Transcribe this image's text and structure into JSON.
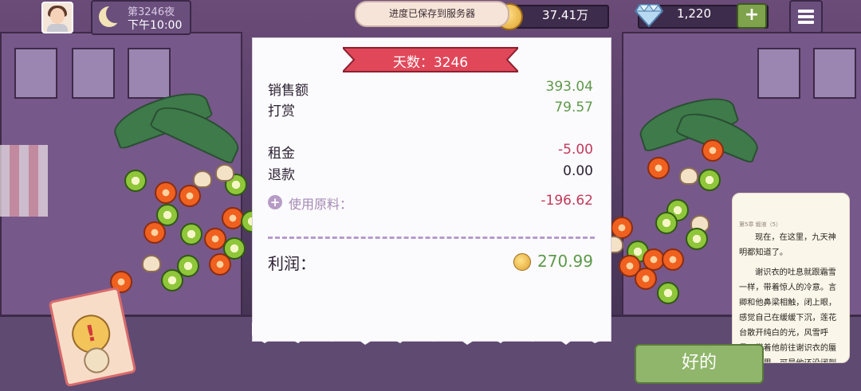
{
  "hud": {
    "night_label": "第3246夜",
    "time": "下午10:00",
    "coins": "37.41万",
    "gems": "1,220",
    "plus_label": "+",
    "save_toast": "进度已保存到服务器"
  },
  "receipt": {
    "day_title": "天数：3246",
    "rows": [
      {
        "label": "销售额",
        "value": "393.04"
      },
      {
        "label": "打赏",
        "value": "79.57"
      },
      {
        "label": "租金",
        "value": "-5.00"
      },
      {
        "label": "退款",
        "value": "0.00"
      }
    ],
    "ingredients_label": "使用原料：",
    "ingredients_value": "-196.62",
    "profit_label": "利润：",
    "profit_value": "270.99"
  },
  "book": {
    "top_line": "第5章  煅液（5）",
    "paragraph1": "现在，在这里，九天神明都知道了。",
    "paragraph2": "谢识衣的吐息就跟霜雪一样，带着惊人的冷意。言卿和他鼻梁相触，闭上眼，感觉自己在缓缓下沉，莲花台散开纯白的光，风雪呼号，带着他前往谢识衣的蜃楼幻境里。可是他还没闭到底，突然，发脚到"
  },
  "ok_label": "好的",
  "colors": {
    "accent_green": "#5e9a4a",
    "accent_red": "#c23a5a",
    "ribbon": "#e0485a"
  }
}
